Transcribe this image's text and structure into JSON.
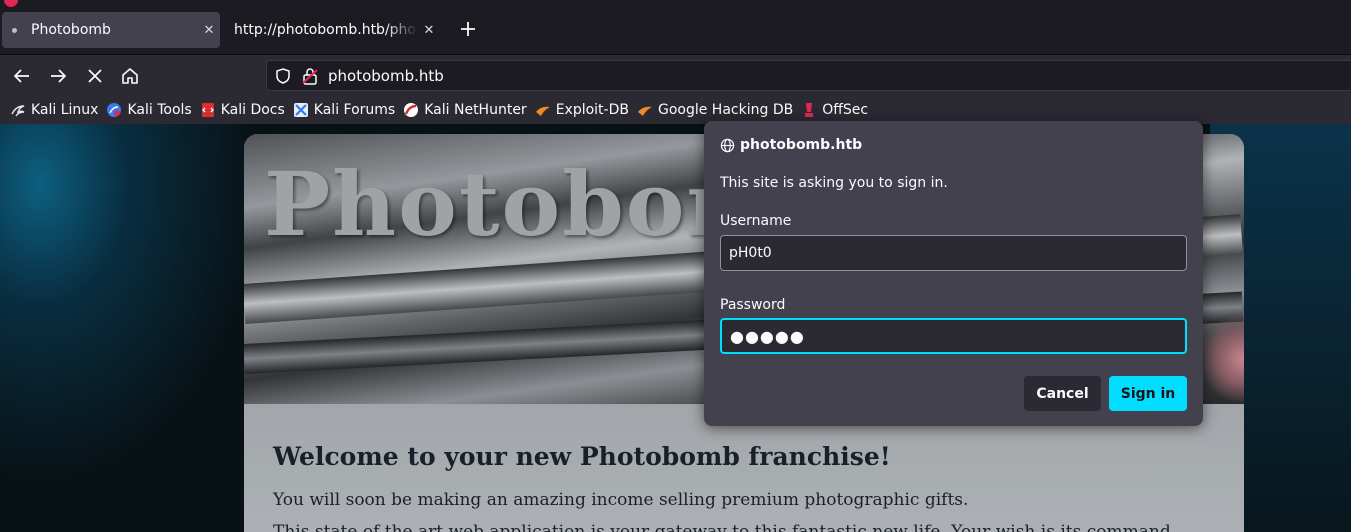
{
  "tabs": [
    {
      "label": "Photobomb",
      "active": true
    },
    {
      "label": "http://photobomb.htb/photobomb",
      "active": false
    }
  ],
  "navbar": {
    "url": "photobomb.htb"
  },
  "bookmarks": [
    {
      "label": "Kali Linux",
      "icon": "kali-dragon-icon"
    },
    {
      "label": "Kali Tools",
      "icon": "kali-tools-icon"
    },
    {
      "label": "Kali Docs",
      "icon": "kali-docs-icon"
    },
    {
      "label": "Kali Forums",
      "icon": "kali-forums-icon"
    },
    {
      "label": "Kali NetHunter",
      "icon": "kali-nethunter-icon"
    },
    {
      "label": "Exploit-DB",
      "icon": "exploit-db-icon"
    },
    {
      "label": "Google Hacking DB",
      "icon": "ghdb-icon"
    },
    {
      "label": "OffSec",
      "icon": "offsec-icon"
    }
  ],
  "page": {
    "hero_title": "Photobomb",
    "welcome": "Welcome to your new Photobomb franchise!",
    "para1": "You will soon be making an amazing income selling premium photographic gifts.",
    "para2": "This state of the art web application is your gateway to this fantastic new life. Your wish is its command."
  },
  "auth_dialog": {
    "host": "photobomb.htb",
    "message": "This site is asking you to sign in.",
    "username_label": "Username",
    "username_value": "pH0t0",
    "password_label": "Password",
    "password_value": "●●●●●",
    "cancel_label": "Cancel",
    "signin_label": "Sign in"
  },
  "colors": {
    "accent": "#00ddff",
    "dialog_bg": "#42414d",
    "toolbar_bg": "#2b2a33",
    "tabstrip_bg": "#1c1b22"
  }
}
